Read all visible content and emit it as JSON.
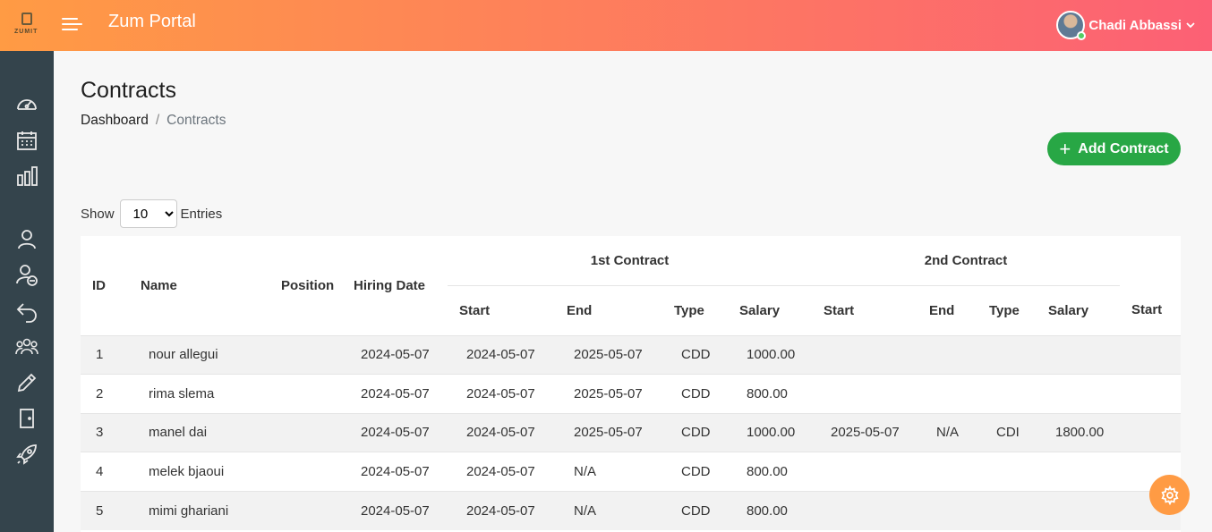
{
  "app": {
    "title": "Zum Portal",
    "logo_text": "ZUMIT"
  },
  "user": {
    "name": "Chadi Abbassi"
  },
  "sidebar": {
    "icons": [
      "dashboard-icon",
      "calendar-icon",
      "chart-icon",
      "user-icon",
      "user-remove-icon",
      "undo-icon",
      "team-icon",
      "pencil-icon",
      "door-icon",
      "rocket-icon"
    ]
  },
  "page": {
    "title": "Contracts"
  },
  "breadcrumb": {
    "home": "Dashboard",
    "separator": "/",
    "current": "Contracts"
  },
  "actions": {
    "add_label": "Add Contract",
    "add_plus": "+"
  },
  "entries": {
    "show_label": "Show",
    "value": "10",
    "suffix": "Entries"
  },
  "table": {
    "columns": {
      "id": "ID",
      "name": "Name",
      "position": "Position",
      "hiring_date": "Hiring Date",
      "group1": "1st Contract",
      "group2": "2nd Contract",
      "start": "Start",
      "end": "End",
      "type": "Type",
      "salary": "Salary"
    },
    "rows": [
      {
        "id": "1",
        "name": "nour allegui",
        "position": "",
        "hiring": "2024-05-07",
        "c1_start": "2024-05-07",
        "c1_end": "2025-05-07",
        "c1_type": "CDD",
        "c1_salary": "1000.00",
        "c2_start": "",
        "c2_end": "",
        "c2_type": "",
        "c2_salary": "",
        "c3_start": ""
      },
      {
        "id": "2",
        "name": "rima slema",
        "position": "",
        "hiring": "2024-05-07",
        "c1_start": "2024-05-07",
        "c1_end": "2025-05-07",
        "c1_type": "CDD",
        "c1_salary": "800.00",
        "c2_start": "",
        "c2_end": "",
        "c2_type": "",
        "c2_salary": "",
        "c3_start": ""
      },
      {
        "id": "3",
        "name": "manel dai",
        "position": "",
        "hiring": "2024-05-07",
        "c1_start": "2024-05-07",
        "c1_end": "2025-05-07",
        "c1_type": "CDD",
        "c1_salary": "1000.00",
        "c2_start": "2025-05-07",
        "c2_end": "N/A",
        "c2_type": "CDI",
        "c2_salary": "1800.00",
        "c3_start": ""
      },
      {
        "id": "4",
        "name": "melek bjaoui",
        "position": "",
        "hiring": "2024-05-07",
        "c1_start": "2024-05-07",
        "c1_end": "N/A",
        "c1_type": "CDD",
        "c1_salary": "800.00",
        "c2_start": "",
        "c2_end": "",
        "c2_type": "",
        "c2_salary": "",
        "c3_start": ""
      },
      {
        "id": "5",
        "name": "mimi ghariani",
        "position": "",
        "hiring": "2024-05-07",
        "c1_start": "2024-05-07",
        "c1_end": "N/A",
        "c1_type": "CDD",
        "c1_salary": "800.00",
        "c2_start": "",
        "c2_end": "",
        "c2_type": "",
        "c2_salary": "",
        "c3_start": ""
      }
    ]
  },
  "colors": {
    "header_start": "#ff9b44",
    "header_end": "#fc6075",
    "sidebar": "#34444c",
    "add_button": "#28a745",
    "settings_button": "#ff9b44"
  }
}
